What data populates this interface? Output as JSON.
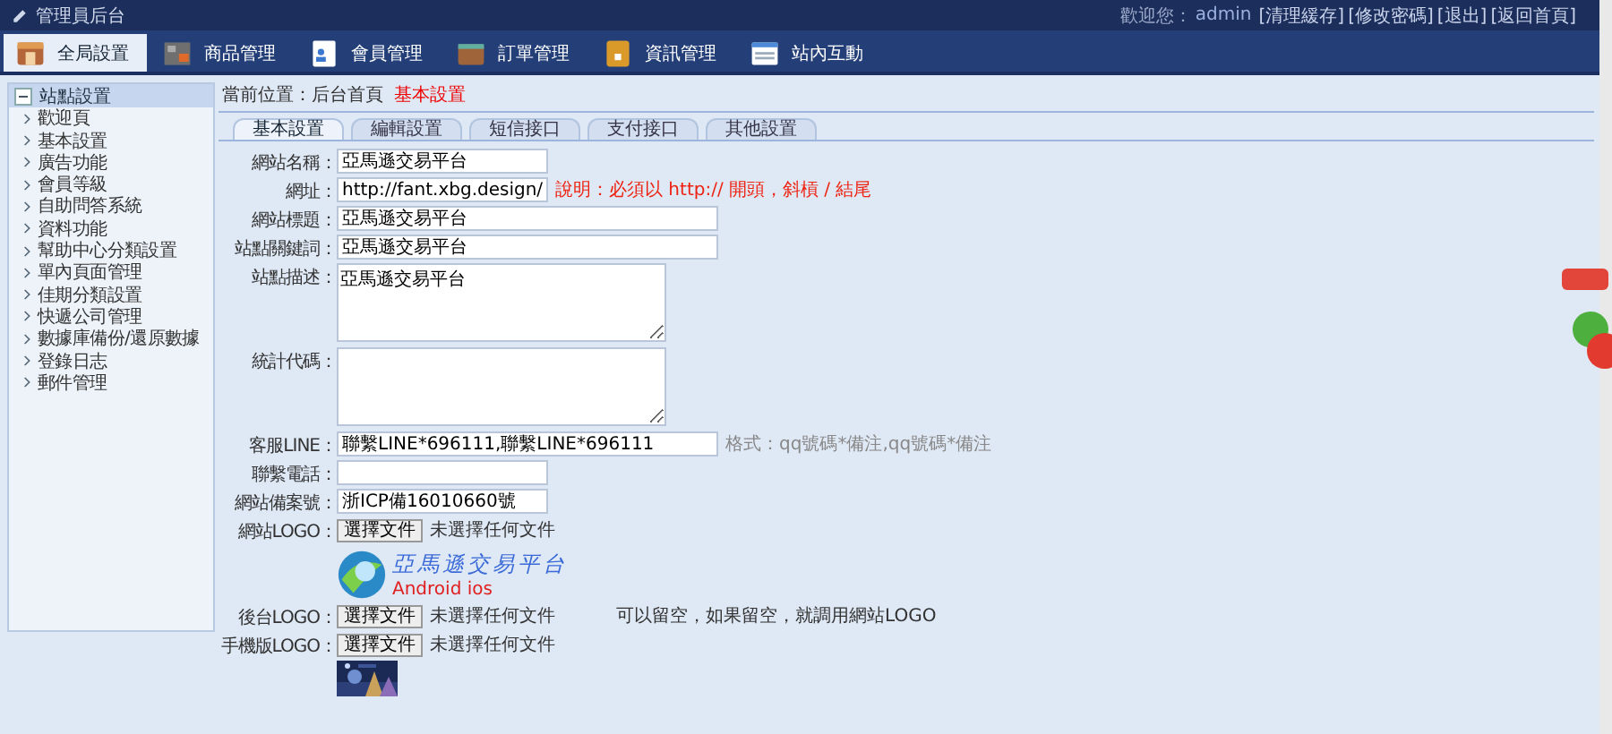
{
  "header": {
    "title": "管理員后台",
    "welcome": "歡迎您：",
    "user": "admin",
    "links": [
      "[清理緩存]",
      "[修改密碼]",
      "[退出]",
      "[返回首頁]"
    ]
  },
  "nav": [
    {
      "label": "全局設置",
      "selected": true
    },
    {
      "label": "商品管理",
      "selected": false
    },
    {
      "label": "會員管理",
      "selected": false
    },
    {
      "label": "訂單管理",
      "selected": false
    },
    {
      "label": "資訊管理",
      "selected": false
    },
    {
      "label": "站內互動",
      "selected": false
    }
  ],
  "sidebar": {
    "title": "站點設置",
    "items": [
      "歡迎頁",
      "基本設置",
      "廣告功能",
      "會員等級",
      "自助問答系統",
      "資料功能",
      "幫助中心分類設置",
      "單內頁面管理",
      "佳期分類設置",
      "快遞公司管理",
      "數據庫備份/還原數據",
      "登錄日志",
      "郵件管理"
    ]
  },
  "breadcrumb": {
    "label": "當前位置：后台首頁",
    "current": "基本設置"
  },
  "tabs": [
    {
      "label": "基本設置",
      "selected": true
    },
    {
      "label": "編輯設置",
      "selected": false
    },
    {
      "label": "短信接口",
      "selected": false
    },
    {
      "label": "支付接口",
      "selected": false
    },
    {
      "label": "其他設置",
      "selected": false
    }
  ],
  "form": [
    {
      "kind": "text",
      "label": "網站名稱：",
      "value": "亞馬遜交易平台"
    },
    {
      "kind": "text",
      "label": "網址：",
      "value": "http://fant.xbg.design/",
      "note": {
        "kind": "warning",
        "text": "說明：必須以 http:// 開頭，斜槓 / 結尾"
      }
    },
    {
      "kind": "wide",
      "label": "網站標題：",
      "value": "亞馬遜交易平台"
    },
    {
      "kind": "wide",
      "label": "站點關鍵詞：",
      "value": "亞馬遜交易平台"
    },
    {
      "kind": "area",
      "label": "站點描述：",
      "value": "亞馬遜交易平台"
    },
    {
      "kind": "area",
      "label": "統計代碼："
    },
    {
      "kind": "wide",
      "label": "客服LINE：",
      "value": "聯繫LINE*696111,聯繫LINE*696111",
      "note": {
        "kind": "hint",
        "text": "格式：qq號碼*備注,qq號碼*備注"
      }
    },
    {
      "kind": "text",
      "label": "聯繫電話："
    },
    {
      "kind": "text",
      "label": "網站備案號：",
      "value": "浙ICP備16010660號"
    },
    {
      "kind": "file",
      "label": "網站LOGO：",
      "button": "選擇文件",
      "status": "未選擇任何文件"
    },
    {
      "kind": "logo",
      "title": "亞馬遜交易平台",
      "subtitle": "Android ios"
    },
    {
      "kind": "file",
      "label": "後台LOGO：",
      "button": "選擇文件",
      "status": "未選擇任何文件",
      "note": {
        "kind": "plain",
        "text": "可以留空，如果留空，就調用網站LOGO"
      }
    },
    {
      "kind": "file",
      "label": "手機版LOGO：",
      "button": "選擇文件",
      "status": "未選擇任何文件"
    },
    {
      "kind": "picture"
    }
  ]
}
